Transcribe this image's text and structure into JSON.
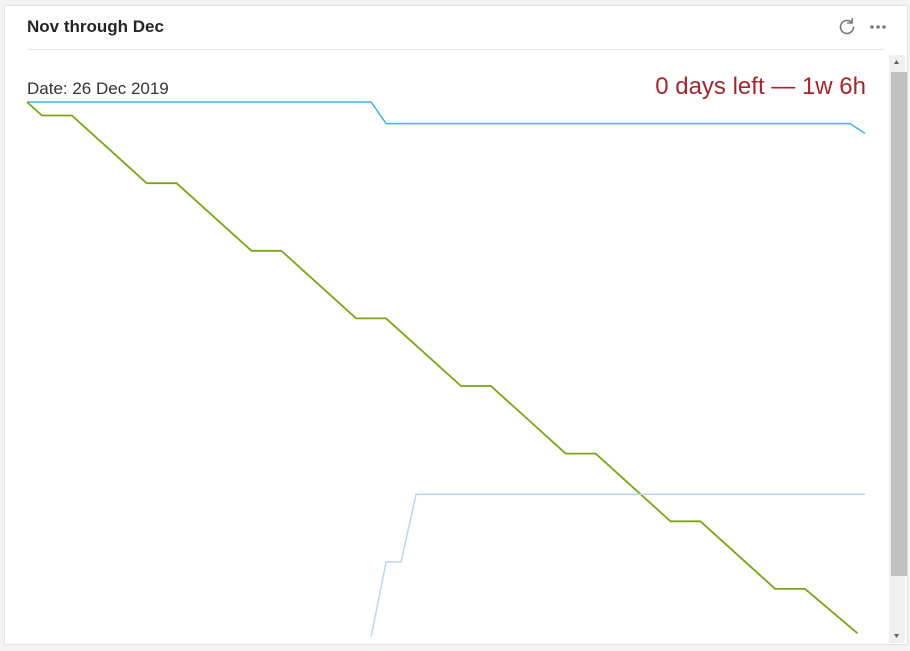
{
  "widget": {
    "title": "Nov through Dec",
    "icons": {
      "refresh": "refresh-icon",
      "more": "more-options-icon"
    }
  },
  "status": {
    "date_label": "Date: 26 Dec 2019",
    "days_left": "0 days left — 1w 6h"
  },
  "colors": {
    "scope": "#3bb6e8",
    "remaining": "#7aa517",
    "completed": "#b6d8ef",
    "days_left_text": "#a4262c"
  },
  "chart_data": {
    "type": "line",
    "x_unit": "day index (Nov 1 = 0)",
    "xlim": [
      0,
      56
    ],
    "ylim": [
      0,
      100
    ],
    "grid": false,
    "legend": "none",
    "series": [
      {
        "key": "scope",
        "x": [
          0,
          23,
          24,
          55,
          56
        ],
        "y": [
          100,
          100,
          96,
          96,
          94.2
        ]
      },
      {
        "key": "remaining",
        "x": [
          0,
          1,
          3,
          8,
          10,
          15,
          17,
          22,
          24,
          29,
          31,
          36,
          38,
          43,
          45,
          50,
          52,
          55.5
        ],
        "y": [
          100,
          97.5,
          97.5,
          85,
          85,
          72.5,
          72.5,
          60,
          60,
          47.5,
          47.5,
          35,
          35,
          22.5,
          22.5,
          10,
          10,
          1.8
        ]
      },
      {
        "key": "completed",
        "x": [
          23,
          24,
          25,
          26,
          56
        ],
        "y": [
          1.2,
          15,
          15,
          27.5,
          27.5
        ]
      }
    ]
  }
}
